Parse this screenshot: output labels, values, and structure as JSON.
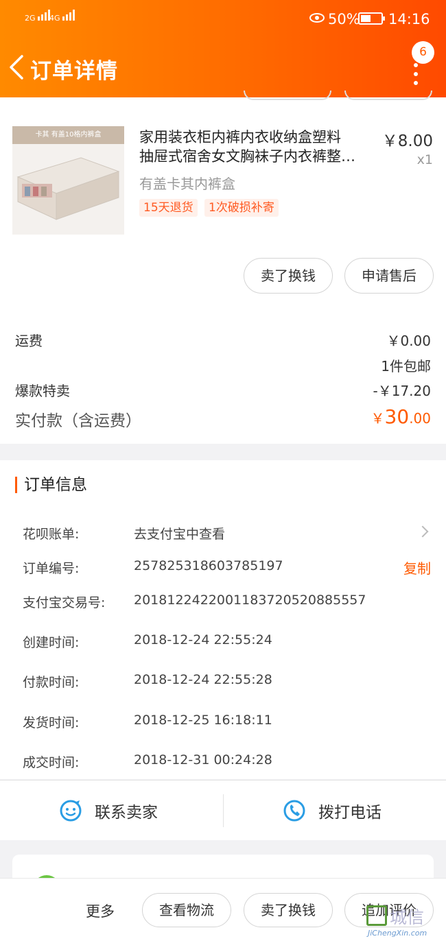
{
  "status_bar": {
    "net1": "2G",
    "net2": "4G",
    "battery_pct": "50%",
    "battery_level": 0.5,
    "time": "14:16"
  },
  "header": {
    "title": "订单详情",
    "badge_count": "6"
  },
  "product": {
    "name_line1": "家用装衣柜内裤内衣收纳盒塑料",
    "name_line2": "抽屉式宿舍女文胸袜子内衣裤整…",
    "spec": "有盖卡其内裤盒",
    "price": "￥8.00",
    "qty": "x1",
    "thumb_caption": "卡其 有盖10格内裤盒",
    "tags": [
      "15天退货",
      "1次破损补寄"
    ],
    "actions": [
      "卖了换钱",
      "申请售后"
    ]
  },
  "fees": {
    "shipping_label": "运费",
    "shipping_value": "￥0.00",
    "shipping_note": "1件包邮",
    "promo_label": "爆款特卖",
    "promo_value": "-￥17.20",
    "total_label": "实付款（含运费）",
    "total_currency": "￥",
    "total_int": "30",
    "total_dec": ".00"
  },
  "order_info": {
    "heading": "订单信息",
    "rows": [
      {
        "label": "花呗账单:",
        "value": "去支付宝中查看"
      },
      {
        "label": "订单编号:",
        "value": "257825318603785197"
      },
      {
        "label": "支付宝交易号:",
        "value": "2018122422001183720520885557"
      },
      {
        "label": "创建时间:",
        "value": "2018-12-24 22:55:24"
      },
      {
        "label": "付款时间:",
        "value": "2018-12-24 22:55:28"
      },
      {
        "label": "发货时间:",
        "value": "2018-12-25 16:18:11"
      },
      {
        "label": "成交时间:",
        "value": "2018-12-31 00:24:28"
      }
    ],
    "copy_label": "复制"
  },
  "contact": {
    "seller": "联系卖家",
    "call": "拨打电话"
  },
  "bottom_bar": {
    "more": "更多",
    "buttons": [
      "查看物流",
      "卖了换钱",
      "追加评价"
    ]
  },
  "watermark": {
    "cn": "城信",
    "en": "JiChengXin.com"
  },
  "colors": {
    "accent": "#ff5a00",
    "header_start": "#ff8a00",
    "header_end": "#ff4a00",
    "icon_blue": "#2a9de4"
  }
}
